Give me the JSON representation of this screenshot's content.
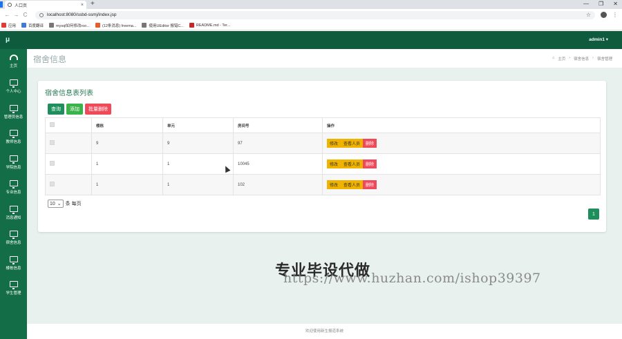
{
  "browser": {
    "tab_title": "人口页",
    "tab_close": "×",
    "new_tab": "+",
    "url": "localhost:8080/ssbd-ssmj/index.jsp",
    "bookmarks": [
      {
        "label": "应用",
        "color": "#e53935"
      },
      {
        "label": "百度翻译",
        "color": "#3d7bd9"
      },
      {
        "label": "mysql如何修改roo...",
        "color": "#777777"
      },
      {
        "label": "(12条消息) freema...",
        "color": "#e85d2a"
      },
      {
        "label": "使用UEditor 报错C...",
        "color": "#777777"
      },
      {
        "label": "README.md - Ter...",
        "color": "#c62828"
      }
    ]
  },
  "header": {
    "logo": "μ",
    "user": "admin1 ▾"
  },
  "sidebar": {
    "items": [
      {
        "label": "主页",
        "icon": "dashboard-icon"
      },
      {
        "label": "个人中心",
        "icon": "monitor-icon"
      },
      {
        "label": "管理员信息",
        "icon": "monitor-icon"
      },
      {
        "label": "教师信息",
        "icon": "monitor-icon"
      },
      {
        "label": "学院信息",
        "icon": "monitor-icon"
      },
      {
        "label": "专业信息",
        "icon": "monitor-icon"
      },
      {
        "label": "消息通知",
        "icon": "monitor-icon"
      },
      {
        "label": "宿舍信息",
        "icon": "monitor-icon"
      },
      {
        "label": "楼栋信息",
        "icon": "monitor-icon"
      },
      {
        "label": "学生管理",
        "icon": "monitor-icon"
      }
    ]
  },
  "page": {
    "title": "宿舍信息",
    "breadcrumb": [
      "主页",
      "宿舍信息",
      "宿舍管理"
    ]
  },
  "card": {
    "title": "宿舍信息表列表",
    "buttons": {
      "query": "查询",
      "add": "添加",
      "batch_delete": "批量删除"
    },
    "columns": [
      "",
      "楼栋",
      "单元",
      "房间号",
      "操作"
    ],
    "rows": [
      {
        "building": "9",
        "unit": "9",
        "room": "97"
      },
      {
        "building": "1",
        "unit": "1",
        "room": "10045"
      },
      {
        "building": "1",
        "unit": "1",
        "room": "102"
      }
    ],
    "row_actions": {
      "edit": "修改",
      "view": "查看人员",
      "delete": "删除"
    },
    "page_size": "10",
    "page_size_suffix": "条 每页",
    "current_page": "1"
  },
  "footer": {
    "text": "欢迎使用新生报道系统"
  },
  "watermark": {
    "title": "专业毕设代做",
    "url": "https://www.huzhan.com/ishop39397"
  }
}
